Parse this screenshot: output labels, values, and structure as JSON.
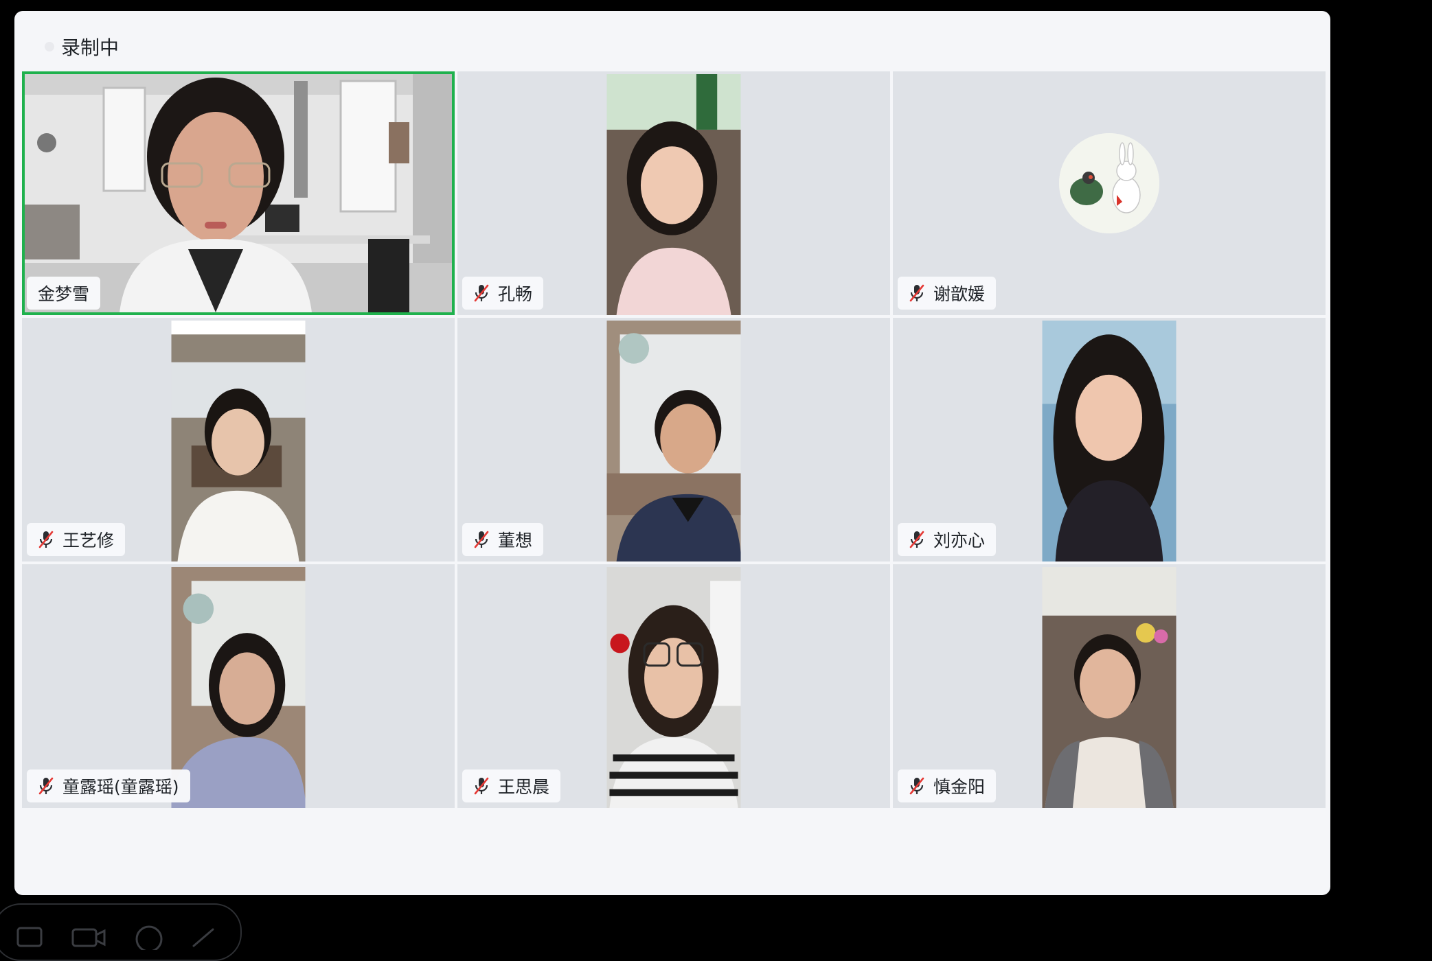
{
  "recording": {
    "label": "录制中"
  },
  "participants": [
    {
      "name": "金梦雪",
      "muted": false,
      "active": true,
      "feed": "office-scene"
    },
    {
      "name": "孔畅",
      "muted": true,
      "active": false,
      "feed": "portrait"
    },
    {
      "name": "谢歆媛",
      "muted": true,
      "active": false,
      "feed": "avatar-rabbit-turtle"
    },
    {
      "name": "王艺修",
      "muted": true,
      "active": false,
      "feed": "portrait"
    },
    {
      "name": "董想",
      "muted": true,
      "active": false,
      "feed": "portrait"
    },
    {
      "name": "刘亦心",
      "muted": true,
      "active": false,
      "feed": "portrait"
    },
    {
      "name": "童露瑶(童露瑶)",
      "muted": true,
      "active": false,
      "feed": "portrait"
    },
    {
      "name": "王思晨",
      "muted": true,
      "active": false,
      "feed": "portrait"
    },
    {
      "name": "慎金阳",
      "muted": true,
      "active": false,
      "feed": "portrait"
    }
  ],
  "colors": {
    "active_border": "#1fb14d",
    "tile_bg": "#dfe2e7",
    "mute_slash": "#e53935"
  },
  "icons": [
    "recording-dot-icon",
    "mic-muted-icon",
    "chevron-right-icon",
    "screen-share-icon",
    "camera-icon",
    "chat-icon",
    "edit-icon"
  ]
}
